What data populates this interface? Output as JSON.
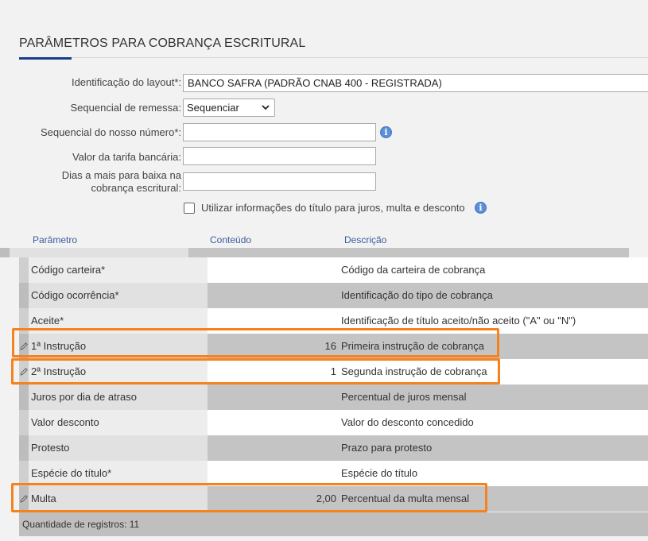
{
  "page": {
    "title": "PARÂMETROS PARA COBRANÇA ESCRITURAL"
  },
  "form": {
    "layout_label": "Identificação do layout*:",
    "layout_value": "BANCO SAFRA (PADRÃO CNAB 400 - REGISTRADA)",
    "remessa_label": "Sequencial de remessa:",
    "remessa_value": "Sequenciar",
    "nosso_numero_label": "Sequencial do nosso número*:",
    "nosso_numero_value": "",
    "tarifa_label": "Valor da tarifa bancária:",
    "tarifa_value": "",
    "dias_label_line1": "Dias a mais para baixa na",
    "dias_label_line2": "cobrança escritural:",
    "dias_value": "",
    "checkbox_label": "Utilizar informações do título para juros, multa e desconto",
    "checkbox_checked": false
  },
  "grid": {
    "columns": [
      "Parâmetro",
      "Conteúdo",
      "Descrição"
    ],
    "rows": [
      {
        "param": "Código carteira*",
        "value": "",
        "desc": "Código da carteira de cobrança",
        "editable": false
      },
      {
        "param": "Código ocorrência*",
        "value": "",
        "desc": "Identificação do tipo de cobrança",
        "editable": false
      },
      {
        "param": "Aceite*",
        "value": "",
        "desc": "Identificação de título aceito/não aceito (\"A\" ou \"N\")",
        "editable": false
      },
      {
        "param": "1ª Instrução",
        "value": "16",
        "desc": "Primeira instrução de cobrança",
        "editable": true
      },
      {
        "param": "2ª Instrução",
        "value": "1",
        "desc": "Segunda instrução de cobrança",
        "editable": true
      },
      {
        "param": "Juros por dia de atraso",
        "value": "",
        "desc": "Percentual de juros mensal",
        "editable": false
      },
      {
        "param": "Valor desconto",
        "value": "",
        "desc": "Valor do desconto concedido",
        "editable": false
      },
      {
        "param": "Protesto",
        "value": "",
        "desc": "Prazo para protesto",
        "editable": false
      },
      {
        "param": "Espécie do título*",
        "value": "",
        "desc": "Espécie do título",
        "editable": false
      },
      {
        "param": "Multa",
        "value": "2,00",
        "desc": "Percentual da multa mensal",
        "editable": true
      }
    ],
    "footer": "Quantidade de registros: 11"
  },
  "colors": {
    "highlight": "#f5821f",
    "accent": "#1a3c8c",
    "header_text": "#3a5d9c"
  }
}
